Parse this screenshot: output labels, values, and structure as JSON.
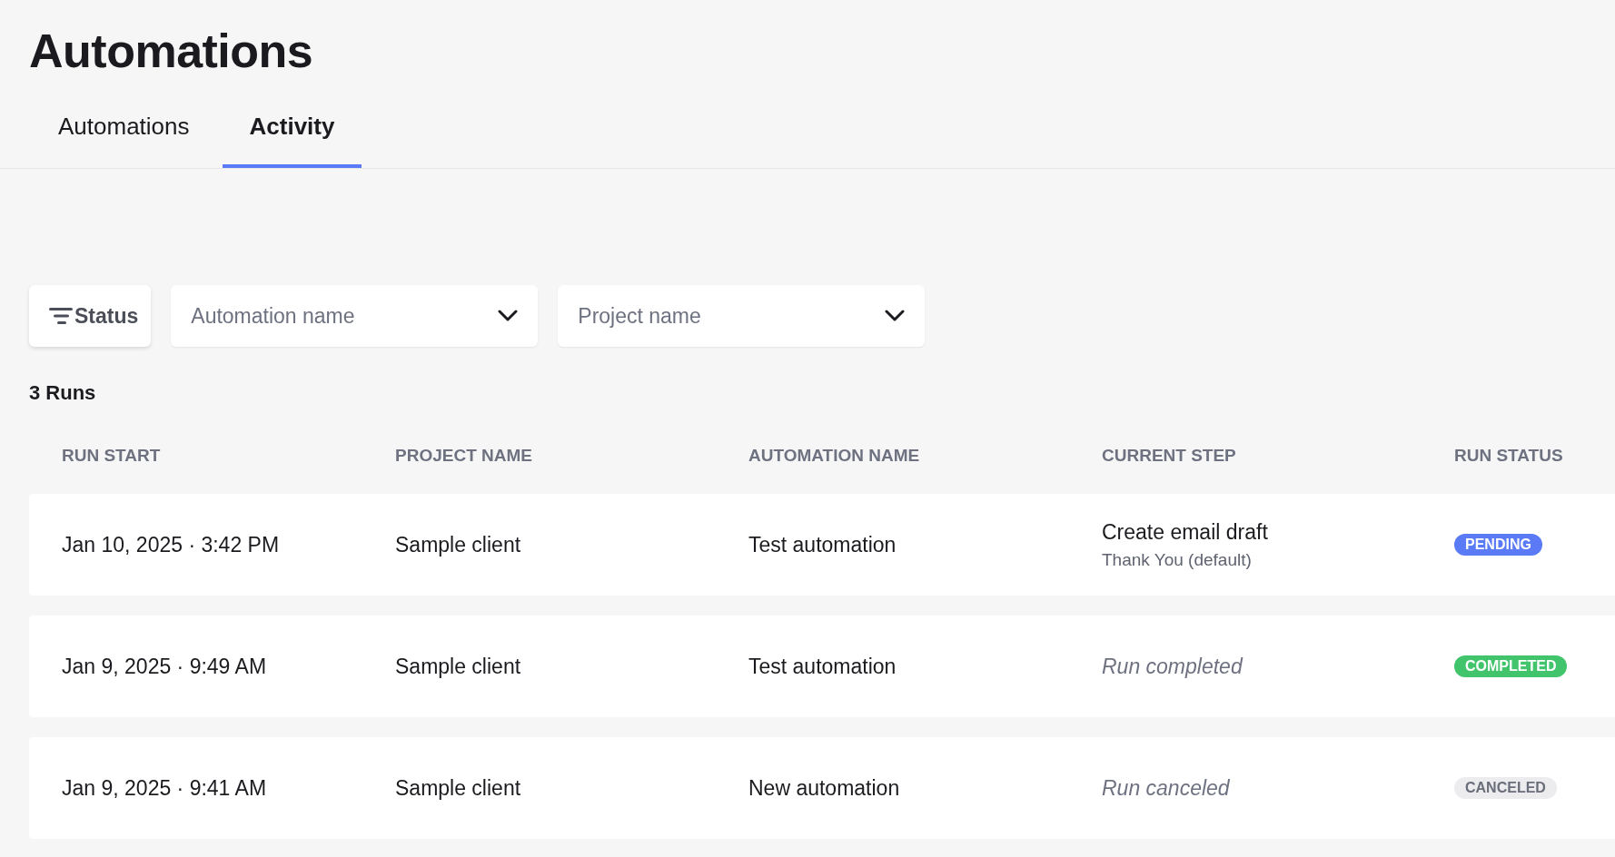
{
  "page": {
    "title": "Automations"
  },
  "tabs": [
    {
      "label": "Automations",
      "selected": false
    },
    {
      "label": "Activity",
      "selected": true
    }
  ],
  "filters": {
    "status_button": "Status",
    "dropdowns": [
      {
        "placeholder": "Automation name"
      },
      {
        "placeholder": "Project name"
      }
    ]
  },
  "run_count": "3 Runs",
  "table": {
    "columns": [
      "RUN START",
      "PROJECT NAME",
      "AUTOMATION NAME",
      "CURRENT STEP",
      "RUN STATUS"
    ],
    "rows": [
      {
        "run_start": "Jan 10, 2025 · 3:42 PM",
        "project": "Sample client",
        "automation": "Test automation",
        "step": {
          "kind": "step",
          "title": "Create email draft",
          "detail": "Thank You (default)"
        },
        "status": {
          "label": "PENDING",
          "kind": "pending"
        }
      },
      {
        "run_start": "Jan 9, 2025 · 9:49 AM",
        "project": "Sample client",
        "automation": "Test automation",
        "step": {
          "kind": "note",
          "text": "Run completed"
        },
        "status": {
          "label": "COMPLETED",
          "kind": "completed"
        }
      },
      {
        "run_start": "Jan 9, 2025 · 9:41 AM",
        "project": "Sample client",
        "automation": "New automation",
        "step": {
          "kind": "note",
          "text": "Run canceled"
        },
        "status": {
          "label": "CANCELED",
          "kind": "canceled"
        }
      }
    ]
  }
}
